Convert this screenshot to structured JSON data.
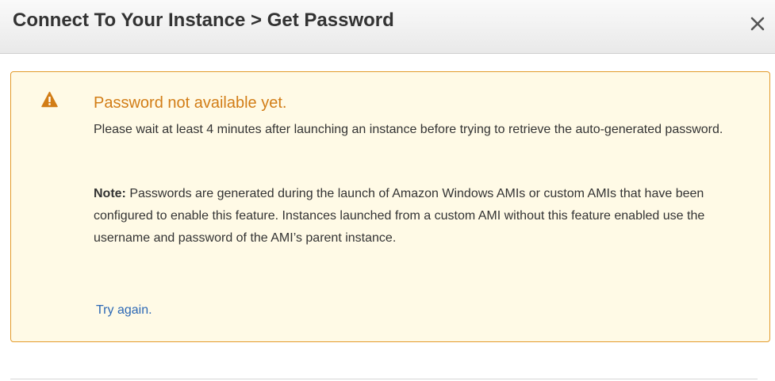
{
  "dialog": {
    "title": "Connect To Your Instance > Get Password",
    "close_icon": "close-icon"
  },
  "alert": {
    "icon": "warning-icon",
    "heading": "Password not available yet.",
    "message": "Please wait at least 4 minutes after launching an instance before trying to retrieve the auto-generated password.",
    "note_label": "Note:",
    "note_text": " Passwords are generated during the launch of Amazon Windows AMIs or custom AMIs that have been configured to enable this feature. Instances launched from a custom AMI without this feature enabled use the username and password of the AMI’s parent instance.",
    "try_again_label": "Try again."
  },
  "colors": {
    "alert_background": "#fffae6",
    "alert_border": "#e39b2b",
    "heading": "#d27d16",
    "link": "#2c68b5"
  }
}
